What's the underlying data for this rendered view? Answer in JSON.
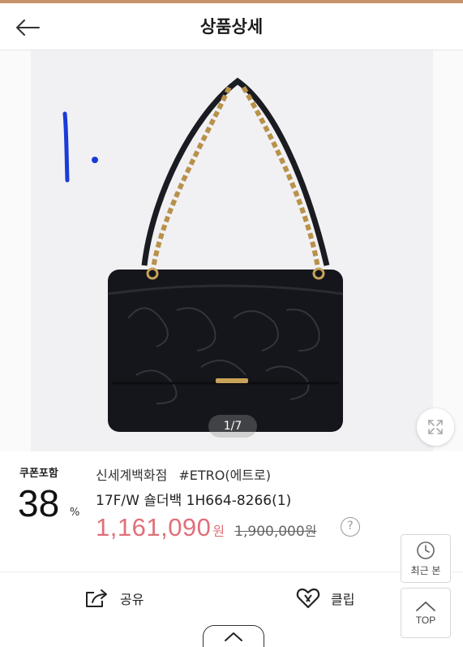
{
  "header": {
    "title": "상품상세",
    "back_icon": "arrow-left-icon"
  },
  "gallery": {
    "page_indicator": "1/7",
    "zoom_icon": "expand-icon",
    "handwritten_mark": "1."
  },
  "product": {
    "coupon_label": "쿠폰포함",
    "discount_value": "38",
    "discount_unit": "%",
    "store": "신세계백화점",
    "brand_tag": "#ETRO(에트로)",
    "name": "17F/W 숄더백 1H664-8266(1)",
    "sale_price": "1,161,090",
    "sale_unit": "원",
    "original_price": "1,900,000",
    "original_unit": "원",
    "help_label": "?"
  },
  "actions": {
    "share_label": "공유",
    "clip_label": "클립",
    "share_icon": "share-icon",
    "clip_icon": "heart-icon"
  },
  "floating": {
    "recent_label": "최근 본",
    "top_label": "TOP"
  },
  "colors": {
    "accent": "#c8936a",
    "sale_price": "#e0707a"
  }
}
